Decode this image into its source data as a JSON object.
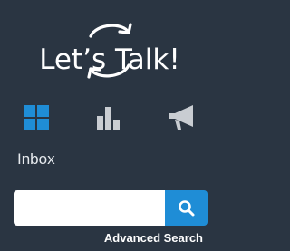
{
  "app": {
    "logo_text": "Let’s Talk!"
  },
  "nav": {
    "items": [
      {
        "label": "Inbox",
        "icon": "grid-icon",
        "color": "#1f8dd6",
        "active": true
      },
      {
        "label": "",
        "icon": "bar-chart-icon",
        "color": "#c9cdd2",
        "active": false
      },
      {
        "label": "",
        "icon": "megaphone-icon",
        "color": "#c9cdd2",
        "active": false
      }
    ],
    "active_label": "Inbox"
  },
  "search": {
    "value": "",
    "placeholder": "",
    "button_icon": "search-icon",
    "advanced_label": "Advanced Search"
  },
  "colors": {
    "background": "#2a3542",
    "accent": "#1f8dd6",
    "icon_inactive": "#c9cdd2"
  }
}
